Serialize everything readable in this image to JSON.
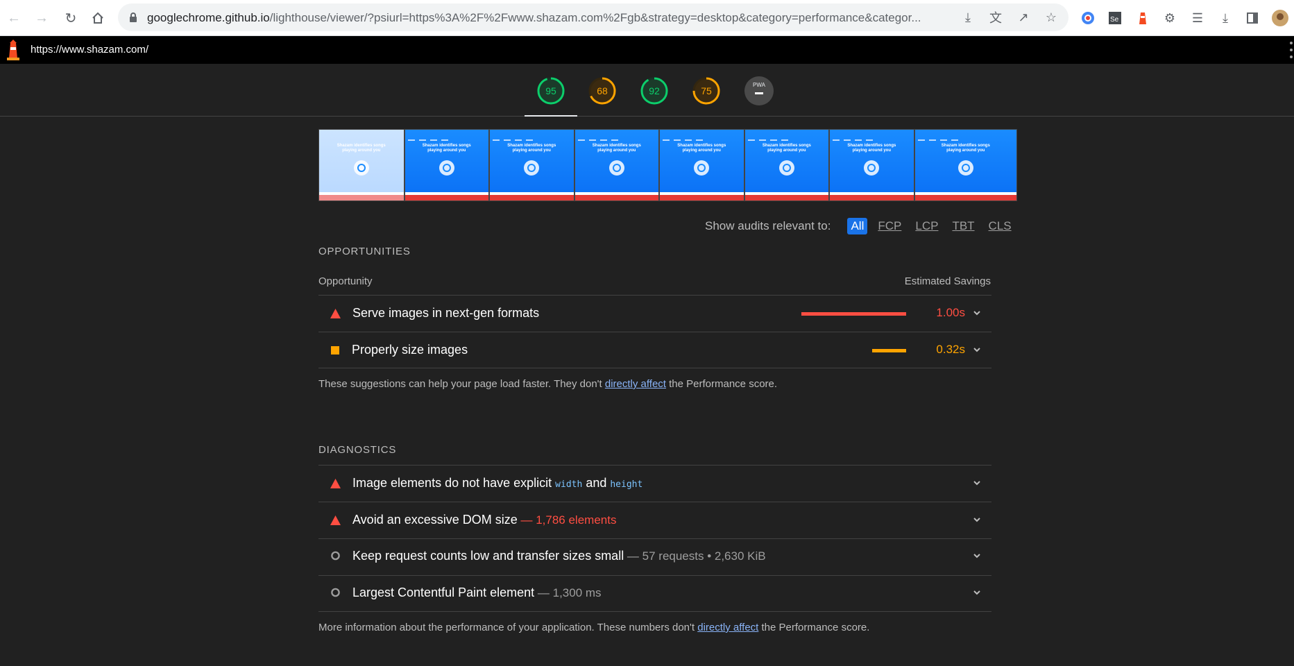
{
  "browser": {
    "url_host": "googlechrome.github.io",
    "url_rest": "/lighthouse/viewer/?psiurl=https%3A%2F%2Fwww.shazam.com%2Fgb&strategy=desktop&category=performance&categor..."
  },
  "lighthouse": {
    "page_url": "https://www.shazam.com/",
    "scores": [
      {
        "value": "95",
        "percent": 95,
        "color": "#0cce6b"
      },
      {
        "value": "68",
        "percent": 68,
        "color": "#ffa400"
      },
      {
        "value": "92",
        "percent": 92,
        "color": "#0cce6b"
      },
      {
        "value": "75",
        "percent": 75,
        "color": "#ffa400"
      }
    ],
    "pwa_label": "PWA"
  },
  "filmstrip": {
    "frame_title_line1": "Shazam identifies songs",
    "frame_title_line2": "playing around you"
  },
  "filter": {
    "label": "Show audits relevant to:",
    "options": [
      "All",
      "FCP",
      "LCP",
      "TBT",
      "CLS"
    ]
  },
  "opportunities": {
    "title": "OPPORTUNITIES",
    "col_left": "Opportunity",
    "col_right": "Estimated Savings",
    "items": [
      {
        "title": "Serve images in next-gen formats",
        "savings": "1.00s",
        "severity": "fail",
        "color": "#ff4e42",
        "bar_fraction": 1.0
      },
      {
        "title": "Properly size images",
        "savings": "0.32s",
        "severity": "average",
        "color": "#ffa400",
        "bar_fraction": 0.32
      }
    ],
    "footnote_before": "These suggestions can help your page load faster. They don't ",
    "footnote_link": "directly affect",
    "footnote_after": " the Performance score."
  },
  "diagnostics": {
    "title": "DIAGNOSTICS",
    "items": [
      {
        "title_a": "Image elements do not have explicit ",
        "code_a": "width",
        "title_b": " and ",
        "code_b": "height",
        "severity": "fail"
      },
      {
        "title": "Avoid an excessive DOM size",
        "detail": " — 1,786 elements",
        "severity": "fail"
      },
      {
        "title": "Keep request counts low and transfer sizes small",
        "detail": " — 57 requests • 2,630 KiB",
        "severity": "info"
      },
      {
        "title": "Largest Contentful Paint element",
        "detail": " — 1,300 ms",
        "severity": "info"
      }
    ],
    "footnote_before": "More information about the performance of your application. These numbers don't ",
    "footnote_link": "directly affect",
    "footnote_after": " the Performance score."
  }
}
